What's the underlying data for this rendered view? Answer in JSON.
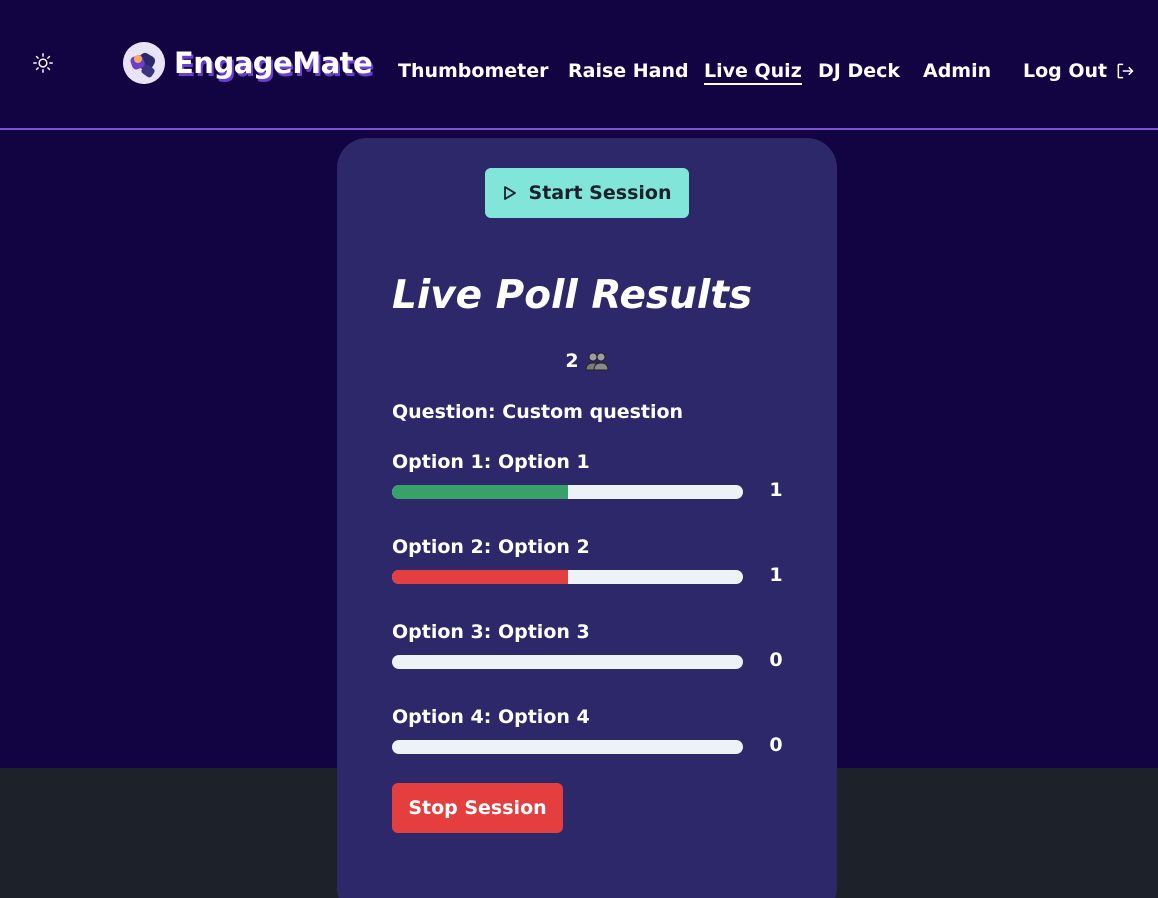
{
  "app": {
    "name": "EngageMate"
  },
  "header": {
    "theme_icon": "sun-icon",
    "nav": [
      {
        "label": "Thumbometer",
        "active": false
      },
      {
        "label": "Raise Hand",
        "active": false
      },
      {
        "label": "Live Quiz",
        "active": true
      },
      {
        "label": "DJ Deck",
        "active": false
      },
      {
        "label": "Admin",
        "active": false
      }
    ],
    "logout_label": "Log Out",
    "logout_icon": "logout-icon"
  },
  "session": {
    "start_label": "Start Session",
    "start_icon": "play-icon",
    "stop_label": "Stop Session"
  },
  "poll": {
    "title": "Live Poll Results",
    "participant_count": "2",
    "participant_icon": "people-icon",
    "question": "Question: Custom question",
    "options": [
      {
        "label": "Option 1: Option 1",
        "count": "1",
        "fraction": 0.5,
        "color": "#38a169"
      },
      {
        "label": "Option 2: Option 2",
        "count": "1",
        "fraction": 0.5,
        "color": "#e53e3e"
      },
      {
        "label": "Option 3: Option 3",
        "count": "0",
        "fraction": 0,
        "color": "#38a169"
      },
      {
        "label": "Option 4: Option 4",
        "count": "0",
        "fraction": 0,
        "color": "#38a169"
      }
    ]
  },
  "colors": {
    "background": "#120342",
    "header_border": "#7b52d6",
    "card": "#2c2869",
    "start_button": "#81e6d9",
    "stop_button": "#e53e3e",
    "bar_track": "#edf2f7",
    "footer": "#1c212a"
  }
}
